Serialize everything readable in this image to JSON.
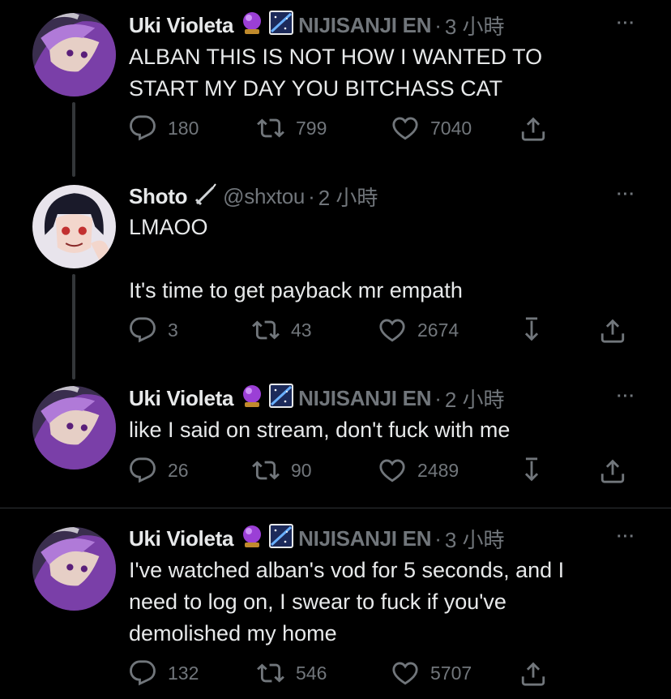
{
  "colors": {
    "background": "#000000",
    "text": "#e7e9ea",
    "muted": "#71767b",
    "line": "#333639"
  },
  "tweets": [
    {
      "name": "Uki Violeta",
      "badges": [
        "crystal-ball",
        "night-sky"
      ],
      "handle": "NIJISANJI EN",
      "time": "3 小時",
      "more": "···",
      "text": "ALBAN THIS IS NOT HOW I WANTED TO\nSTART MY DAY YOU BITCHASS CAT",
      "replies": "180",
      "retweets": "799",
      "likes": "7040"
    },
    {
      "name": "Shoto",
      "badges": [
        "sword"
      ],
      "handle": "@shxtou",
      "time": "2 小時",
      "more": "···",
      "text": "LMAOO\n\nIt's time to get payback mr empath",
      "replies": "3",
      "retweets": "43",
      "likes": "2674"
    },
    {
      "name": "Uki Violeta",
      "badges": [
        "crystal-ball",
        "night-sky"
      ],
      "handle": "NIJISANJI EN",
      "time": "2 小時",
      "more": "···",
      "text": "like I said on stream, don't fuck with me",
      "replies": "26",
      "retweets": "90",
      "likes": "2489"
    },
    {
      "name": "Uki Violeta",
      "badges": [
        "crystal-ball",
        "night-sky"
      ],
      "handle": "NIJISANJI EN",
      "time": "3 小時",
      "more": "···",
      "text": "I've watched alban's vod for 5 seconds, and I\nneed to log on, I swear to fuck if you've\ndemolished my home",
      "replies": "132",
      "retweets": "546",
      "likes": "5707"
    }
  ]
}
